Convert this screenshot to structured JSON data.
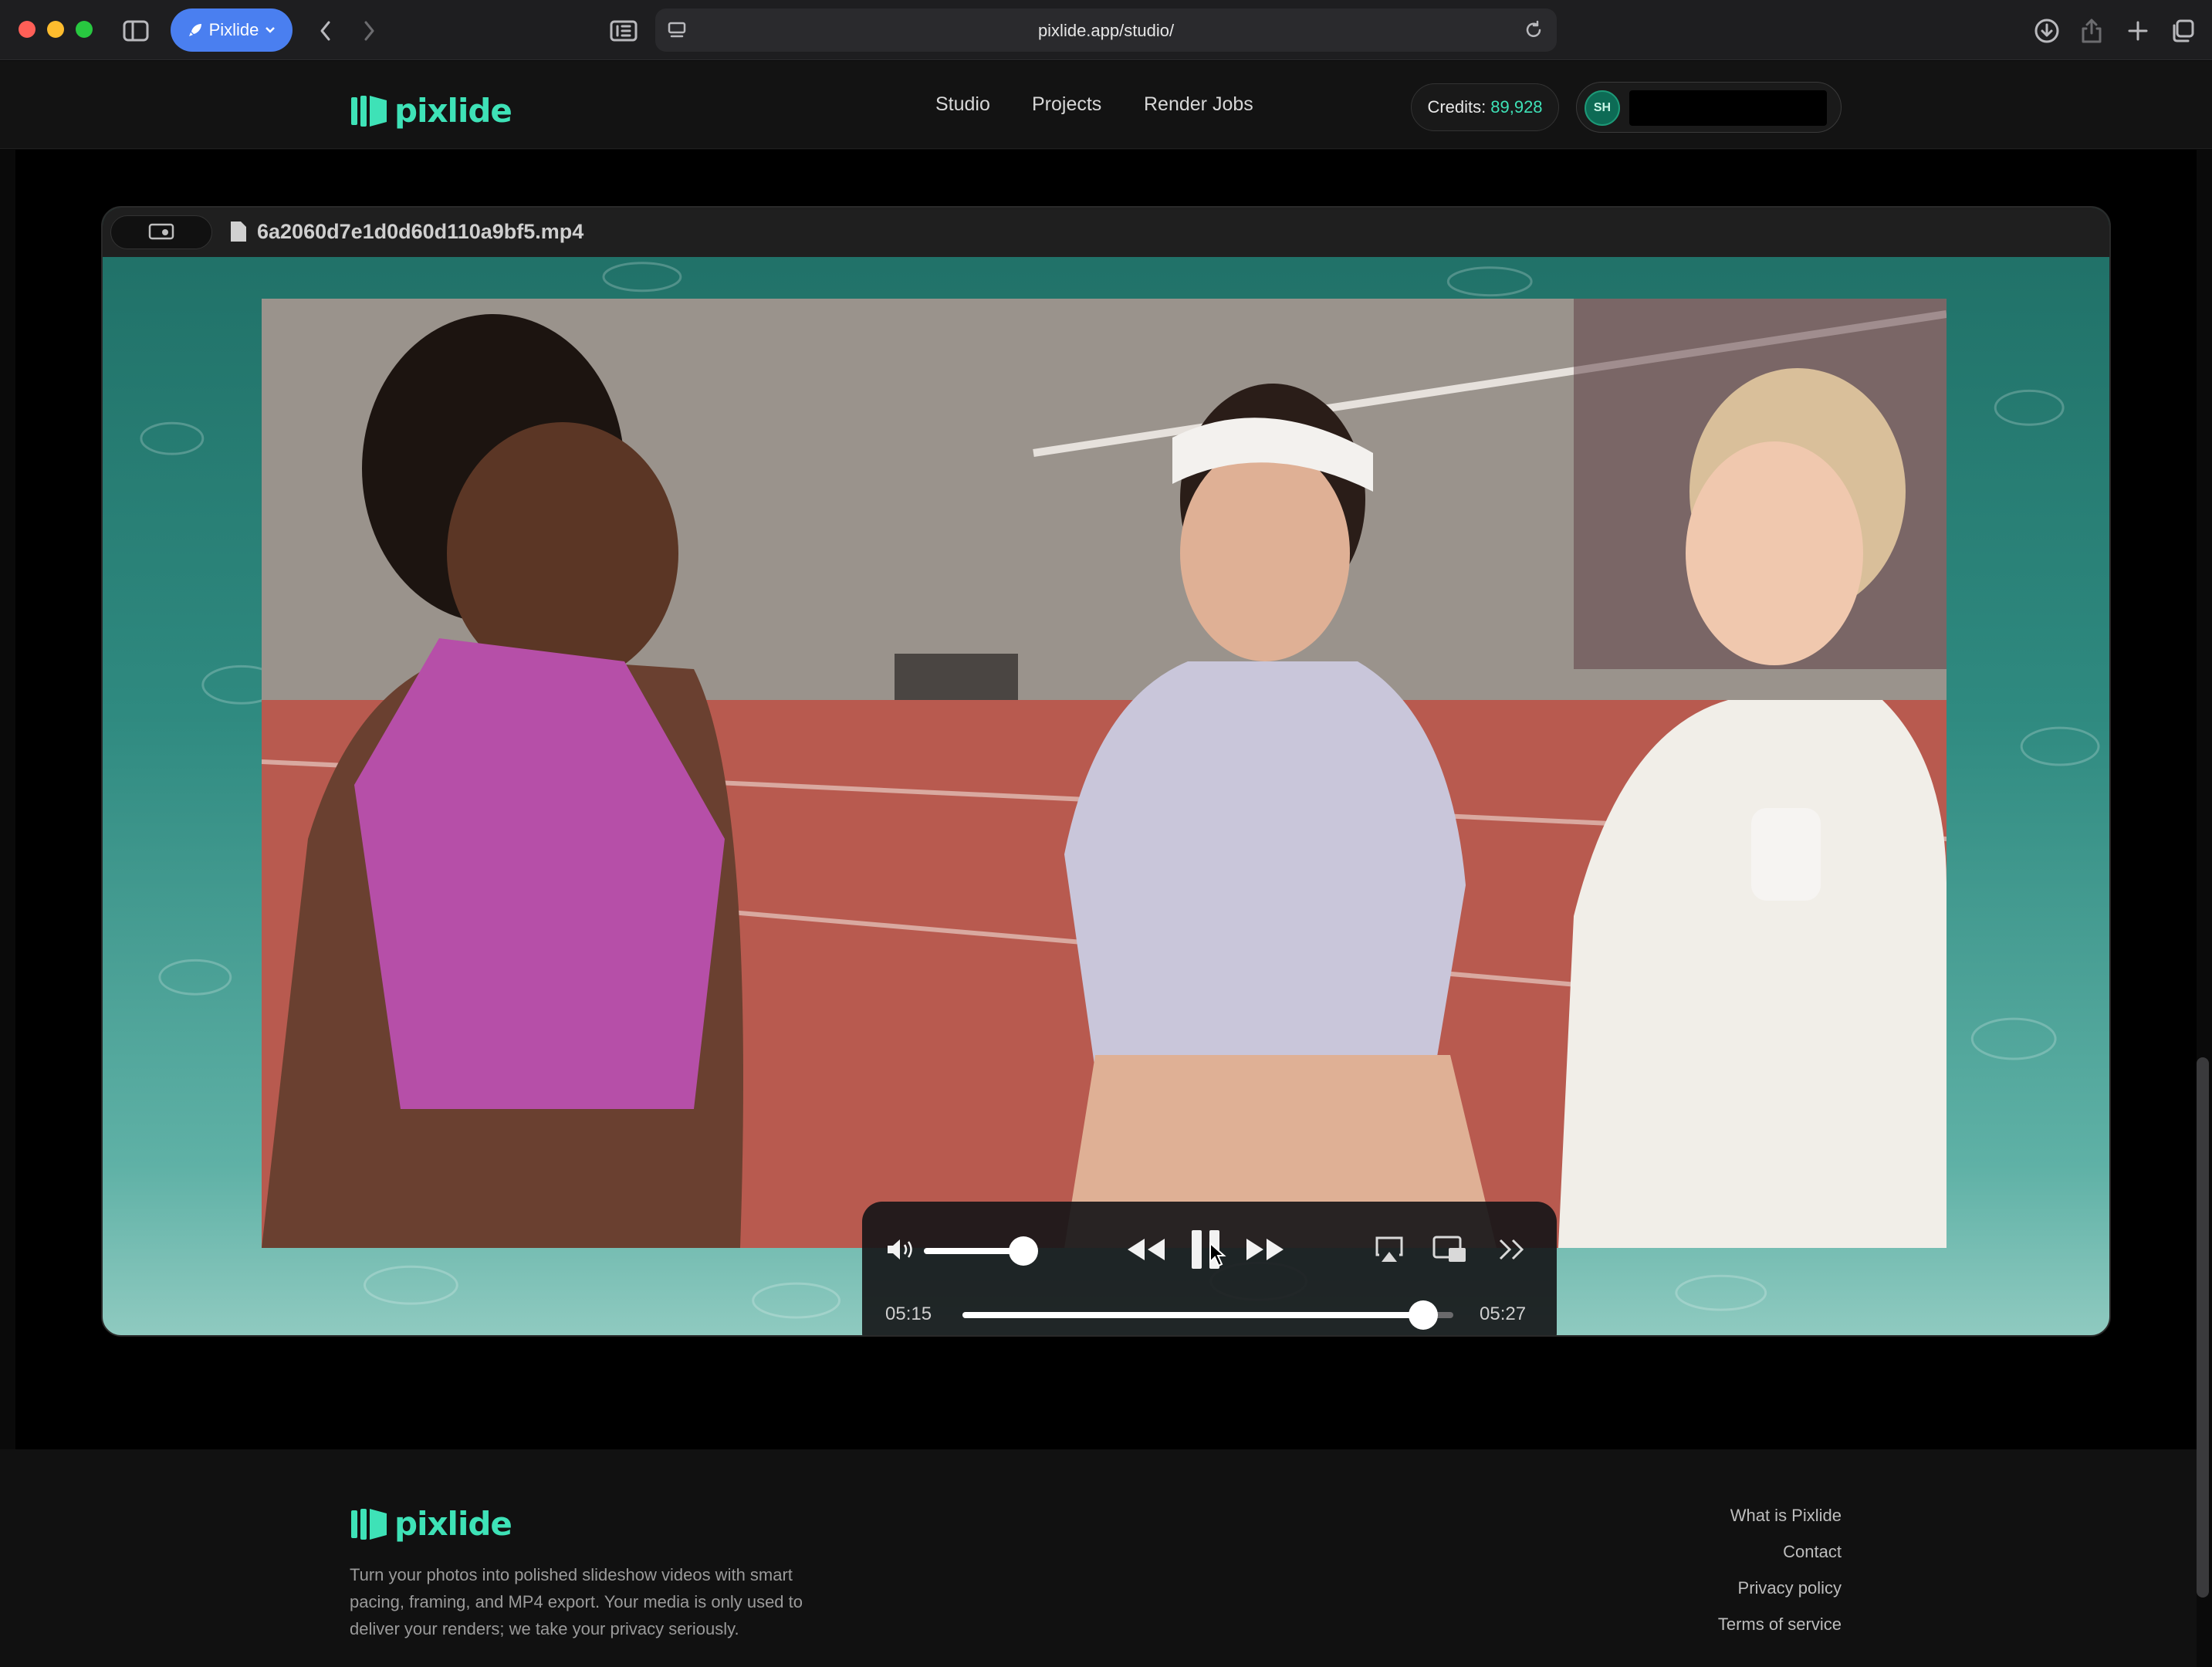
{
  "browser": {
    "profile_label": "Pixlide",
    "url": "pixlide.app/studio/"
  },
  "header": {
    "logo": "pixlide",
    "nav": [
      "Studio",
      "Projects",
      "Render Jobs"
    ],
    "credits_label": "Credits:",
    "credits_value": "89,928",
    "user_initials": "SH"
  },
  "player": {
    "filename": "6a2060d7e1d0d60d110a9bf5.mp4",
    "current_time": "05:15",
    "remaining_time": "05:27",
    "progress_fraction": 0.93,
    "volume_fraction": 0.9
  },
  "footer": {
    "logo": "pixlide",
    "tagline": "Turn your photos into polished slideshow videos with smart pacing, framing, and MP4 export. Your media is only used to deliver your renders; we take your privacy seriously.",
    "links": [
      "What is Pixlide",
      "Contact",
      "Privacy policy",
      "Terms of service"
    ]
  },
  "colors": {
    "accent": "#3ee2b7",
    "browser_profile": "#4a7ff0"
  }
}
